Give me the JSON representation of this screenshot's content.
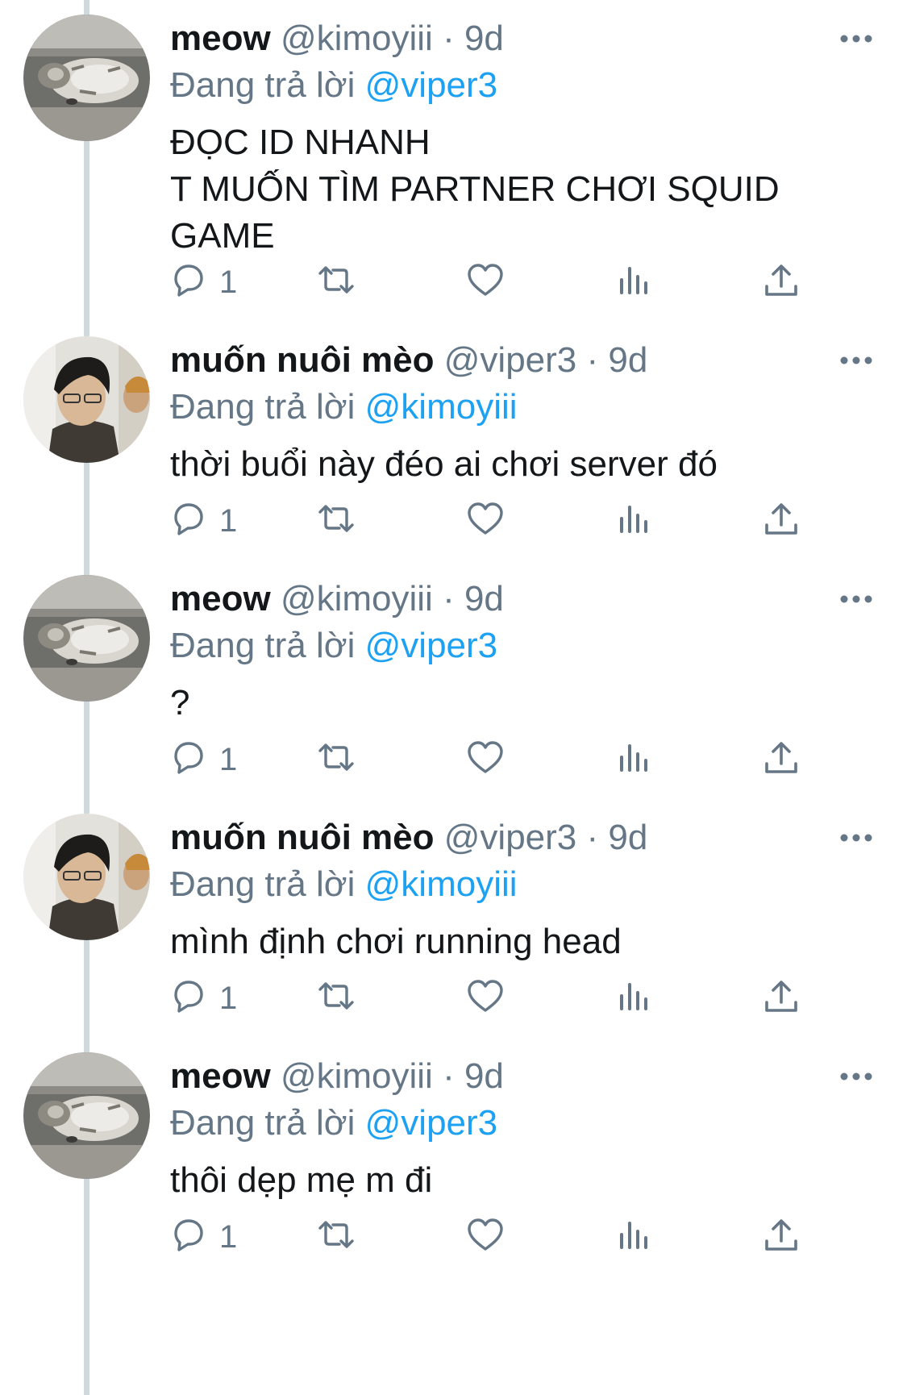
{
  "colors": {
    "text": "#14171a",
    "secondary": "#657786",
    "link": "#1da1f2",
    "thread_line": "#cfd9de"
  },
  "reply_prefix": "Đang trả lời",
  "tweets": [
    {
      "name": "meow",
      "handle": "@kimoyiii",
      "separator": "·",
      "time": "9d",
      "reply_to": "@viper3",
      "avatar": "cat-avatar",
      "lines": [
        "ĐỌC ID NHANH",
        "T MUỐN TÌM PARTNER CHƠI SQUID",
        "GAME"
      ],
      "reply_count": "1"
    },
    {
      "name": "muốn nuôi mèo",
      "handle": "@viper3",
      "separator": "·",
      "time": "9d",
      "reply_to": "@kimoyiii",
      "avatar": "person-avatar",
      "lines": [
        "thời buổi này đéo ai chơi server đó"
      ],
      "reply_count": "1"
    },
    {
      "name": "meow",
      "handle": "@kimoyiii",
      "separator": "·",
      "time": "9d",
      "reply_to": "@viper3",
      "avatar": "cat-avatar",
      "lines": [
        "?"
      ],
      "reply_count": "1"
    },
    {
      "name": "muốn nuôi mèo",
      "handle": "@viper3",
      "separator": "·",
      "time": "9d",
      "reply_to": "@kimoyiii",
      "avatar": "person-avatar",
      "lines": [
        "mình định chơi running head"
      ],
      "reply_count": "1"
    },
    {
      "name": "meow",
      "handle": "@kimoyiii",
      "separator": "·",
      "time": "9d",
      "reply_to": "@viper3",
      "avatar": "cat-avatar",
      "lines": [
        "thôi dẹp mẹ m đi"
      ],
      "reply_count": "1"
    }
  ]
}
